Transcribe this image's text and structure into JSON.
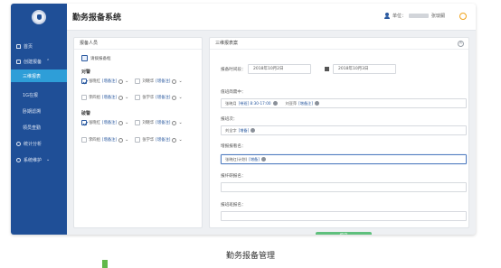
{
  "app": {
    "title": "勤务报备系统"
  },
  "header": {
    "user_prefix": "单位：",
    "user_suffix": "张琰嗣"
  },
  "sidebar": {
    "items": [
      {
        "label": "首页",
        "icon": "home-icon"
      },
      {
        "label": "创建报备",
        "icon": "list-icon"
      },
      {
        "label": "三维报表",
        "sub": true,
        "active": true
      },
      {
        "label": "1G在报",
        "sub": true
      },
      {
        "label": "卧期滤溯",
        "sub": true
      },
      {
        "label": "领员查勤",
        "sub": true
      },
      {
        "label": "统计分析",
        "icon": "chart-icon"
      },
      {
        "label": "系统维护",
        "icon": "settings-icon"
      }
    ]
  },
  "left_panel": {
    "title": "报备人员",
    "select_all_label": "请拨报备框",
    "groups": [
      {
        "label": "对警",
        "rows": [
          [
            {
              "name": "张晓红",
              "remark": "[增备注]",
              "checked": true
            },
            {
              "name": "刘晓华",
              "remark": "[增备注]",
              "checked": false
            }
          ]
        ]
      },
      {
        "label": "破警",
        "rows": [
          [
            {
              "name": "张晓红",
              "remark": "[增备注]",
              "checked": true
            },
            {
              "name": "刘晓华",
              "remark": "[增备注]",
              "checked": false
            }
          ],
          [
            {
              "name": "李四组",
              "remark": "[增备注]",
              "checked": false
            },
            {
              "name": "张学华",
              "remark": "[增备注]",
              "checked": false
            }
          ]
        ]
      }
    ],
    "extra_row": [
      {
        "name": "李四组",
        "remark": "[增备注]",
        "checked": false
      },
      {
        "name": "张学华",
        "remark": "[增备注]",
        "checked": false
      }
    ]
  },
  "right_panel": {
    "title": "三维报表案",
    "date_label": "报备时间段：",
    "date_from": "2018年10月2日",
    "date_to": "2018年10月3日",
    "section1_label": "值班简需中：",
    "section1_tags": [
      {
        "name": "张晓月",
        "detail": "[带班] 8:30-17:00"
      },
      {
        "name": "刘亚萍",
        "detail": "[增备注]"
      }
    ],
    "section2_label": "报班次：",
    "section2_tags": [
      {
        "name": "刘全字",
        "detail": "[增备]"
      }
    ],
    "section3_label": "增报报看名：",
    "section3_tags": [
      {
        "name": "张晓红(计划)",
        "detail": "[增备]"
      }
    ],
    "section4_label": "报纤研报名：",
    "section5_label": "报班班报名：",
    "submit_label": "提交"
  },
  "caption": "勤务报备管理",
  "colors": {
    "sidebar_bg": "#1f4f97",
    "active_item": "#2e9ed8",
    "submit_btn": "#5fc07d",
    "accent": "#2b5aa0"
  }
}
